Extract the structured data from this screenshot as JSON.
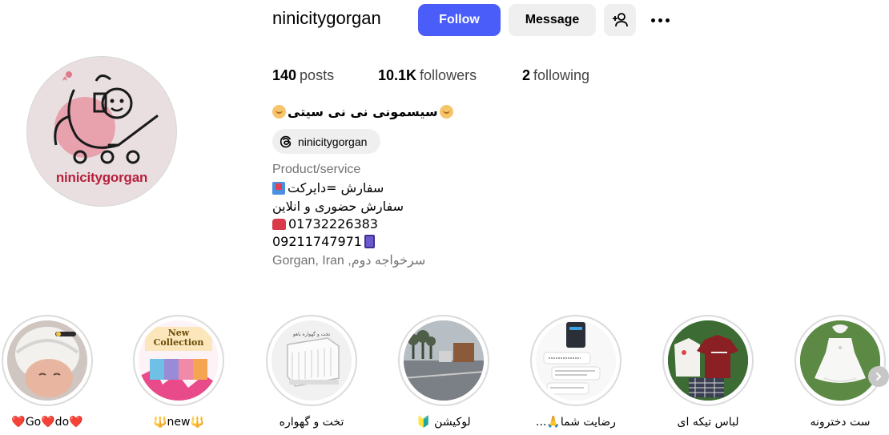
{
  "profile": {
    "username": "ninicitygorgan",
    "avatar_text": "ninicitygorgan",
    "full_name": "سیسمونی نی نی سیتی",
    "threads_handle": "ninicitygorgan",
    "category": "Product/service",
    "bio_lines": [
      "سفارش =دایرکت",
      "سفارش حضوری و انلاین",
      "01732226383",
      "09211747971"
    ],
    "location": "Gorgan, Iran ,سرخواجه دوم"
  },
  "actions": {
    "follow": "Follow",
    "message": "Message"
  },
  "stats": {
    "posts_count": "140",
    "posts_label": "posts",
    "followers_count": "10.1K",
    "followers_label": "followers",
    "following_count": "2",
    "following_label": "following"
  },
  "highlights": [
    {
      "label": "❤️Go❤️do❤️"
    },
    {
      "label": "🔱new🔱"
    },
    {
      "label": "تخت و گهواره"
    },
    {
      "label": "لوکیشن 🔰"
    },
    {
      "label": "رضایت شما🙏..."
    },
    {
      "label": "لباس تیکه ای"
    },
    {
      "label": "ست دخترونه"
    }
  ],
  "highlight_texts": {
    "new_collection": "New Collection",
    "crib_caption": "تخت و گهواره باهو"
  },
  "colors": {
    "follow_bg": "#4a5df9",
    "secondary_bg": "#efefef",
    "muted_text": "#737373",
    "brand_pink": "#b7203d"
  },
  "icons": {
    "suggest": "person-plus-icon",
    "more": "more-dots-icon",
    "threads": "threads-icon",
    "next": "chevron-right-icon"
  }
}
